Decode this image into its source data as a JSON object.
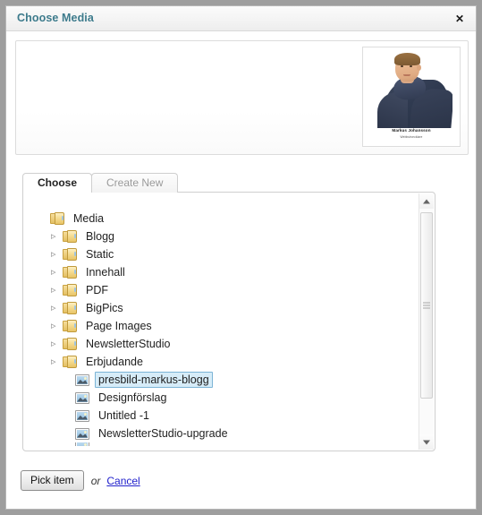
{
  "dialog": {
    "title": "Choose Media",
    "close_label": "✕"
  },
  "preview": {
    "thumbnail": {
      "icon": "person-photo",
      "caption": "Markus Johansson",
      "subcaption": "Webbutvecklare"
    }
  },
  "tabs": [
    {
      "label": "Choose",
      "active": true
    },
    {
      "label": "Create New",
      "active": false
    }
  ],
  "tree": {
    "items": [
      {
        "label": "Media",
        "type": "folder",
        "depth": 0,
        "expandable": false,
        "selected": false
      },
      {
        "label": "Blogg",
        "type": "folder",
        "depth": 1,
        "expandable": true,
        "selected": false
      },
      {
        "label": "Static",
        "type": "folder",
        "depth": 1,
        "expandable": true,
        "selected": false
      },
      {
        "label": "Innehall",
        "type": "folder",
        "depth": 1,
        "expandable": true,
        "selected": false
      },
      {
        "label": "PDF",
        "type": "folder",
        "depth": 1,
        "expandable": true,
        "selected": false
      },
      {
        "label": "BigPics",
        "type": "folder",
        "depth": 1,
        "expandable": true,
        "selected": false
      },
      {
        "label": "Page Images",
        "type": "folder",
        "depth": 1,
        "expandable": true,
        "selected": false
      },
      {
        "label": "NewsletterStudio",
        "type": "folder",
        "depth": 1,
        "expandable": true,
        "selected": false
      },
      {
        "label": "Erbjudande",
        "type": "folder",
        "depth": 1,
        "expandable": true,
        "selected": false
      },
      {
        "label": "presbild-markus-blogg",
        "type": "image",
        "depth": 2,
        "expandable": false,
        "selected": true
      },
      {
        "label": "Designförslag",
        "type": "image",
        "depth": 2,
        "expandable": false,
        "selected": false
      },
      {
        "label": "Untitled -1",
        "type": "image",
        "depth": 2,
        "expandable": false,
        "selected": false
      },
      {
        "label": "NewsletterStudio-upgrade",
        "type": "image",
        "depth": 2,
        "expandable": false,
        "selected": false
      },
      {
        "label": "",
        "type": "image",
        "depth": 2,
        "expandable": false,
        "selected": false,
        "clipped": true
      }
    ]
  },
  "scrollbar": {
    "up_icon": "chevron-up-icon",
    "down_icon": "chevron-down-icon"
  },
  "footer": {
    "pick_label": "Pick item",
    "or_label": "or",
    "cancel_label": "Cancel"
  },
  "colors": {
    "title": "#3d7b8c",
    "selection_bg": "#d6ecf8",
    "selection_border": "#7cb4d6",
    "link": "#2222cc",
    "page_bg": "#9e9e9e"
  }
}
